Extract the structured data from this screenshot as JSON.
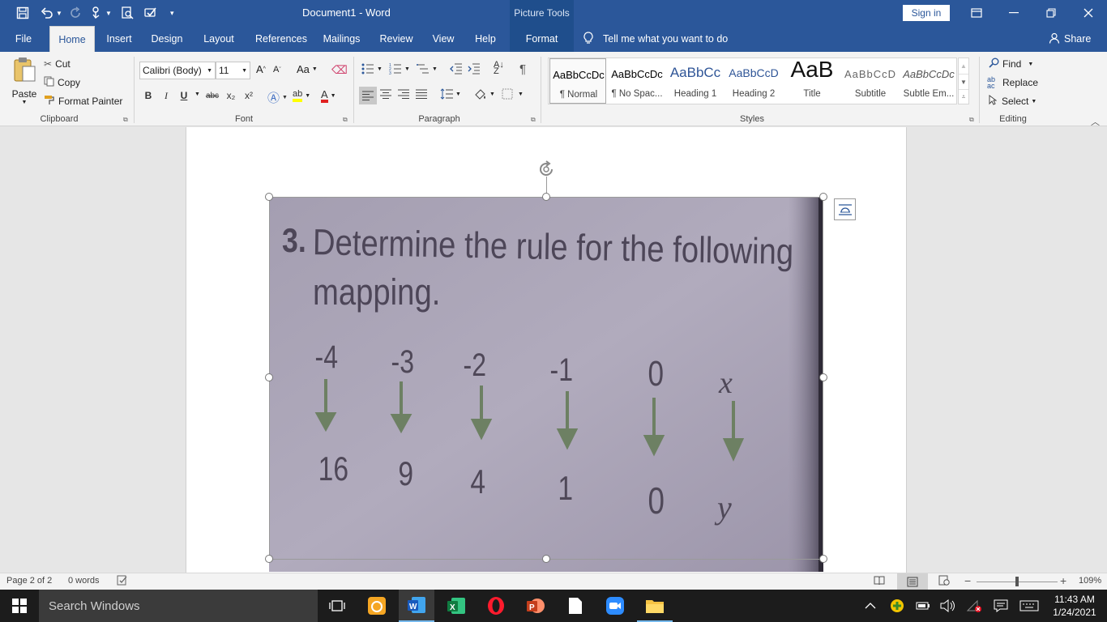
{
  "title_bar": {
    "document_title": "Document1  -  Word",
    "contextual_tab_group": "Picture Tools",
    "sign_in_label": "Sign in",
    "quick_access_icons": [
      "save-icon",
      "undo-icon",
      "redo-icon",
      "touch-mode-icon",
      "print-preview-icon",
      "spelling-icon",
      "customize-icon"
    ]
  },
  "tabs": [
    "File",
    "Home",
    "Insert",
    "Design",
    "Layout",
    "References",
    "Mailings",
    "Review",
    "View",
    "Help",
    "Format"
  ],
  "active_tab": "Home",
  "tell_me_placeholder": "Tell me what you want to do",
  "share_label": "Share",
  "clipboard": {
    "paste_label": "Paste",
    "cut_label": "Cut",
    "copy_label": "Copy",
    "format_painter_label": "Format Painter",
    "group_label": "Clipboard"
  },
  "font": {
    "font_name": "Calibri (Body)",
    "font_size": "11",
    "group_label": "Font",
    "buttons": [
      "B",
      "I",
      "U",
      "abc",
      "x₂",
      "x²"
    ]
  },
  "paragraph": {
    "group_label": "Paragraph"
  },
  "styles": {
    "group_label": "Styles",
    "items": [
      {
        "preview": "AaBbCcDc",
        "name": "¶ Normal"
      },
      {
        "preview": "AaBbCcDc",
        "name": "¶ No Spac..."
      },
      {
        "preview": "AaBbCc",
        "name": "Heading 1"
      },
      {
        "preview": "AaBbCcD",
        "name": "Heading 2"
      },
      {
        "preview": "AaB",
        "name": "Title"
      },
      {
        "preview": "AaBbCcD",
        "name": "Subtitle"
      },
      {
        "preview": "AaBbCcDc",
        "name": "Subtle Em..."
      }
    ]
  },
  "editing": {
    "find_label": "Find",
    "replace_label": "Replace",
    "select_label": "Select",
    "group_label": "Editing"
  },
  "photo": {
    "line1_num": "3.",
    "line1_text": "Determine the rule for the following",
    "line2_text": "mapping.",
    "inputs": [
      "-4",
      "-3",
      "-2",
      "-1",
      "0",
      "x"
    ],
    "outputs": [
      "16",
      "9",
      "4",
      "1",
      "0",
      "y"
    ]
  },
  "status_bar": {
    "page": "Page 2 of 2",
    "words": "0 words",
    "zoom": "109%"
  },
  "taskbar": {
    "search_placeholder": "Search Windows",
    "time": "11:43 AM",
    "date": "1/24/2021"
  }
}
